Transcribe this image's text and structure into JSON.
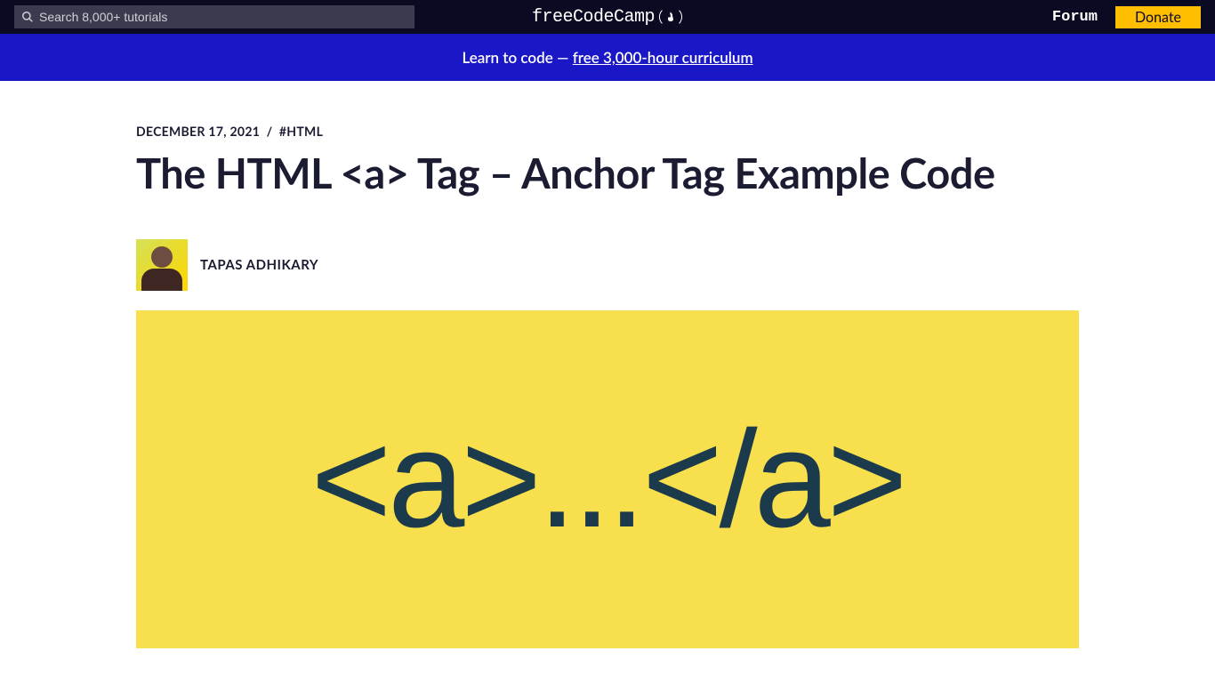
{
  "header": {
    "search_placeholder": "Search 8,000+ tutorials",
    "logo_text": "freeCodeCamp",
    "forum_label": "Forum",
    "donate_label": "Donate"
  },
  "banner": {
    "prefix": "Learn to code — ",
    "link_text": "free 3,000-hour curriculum"
  },
  "article": {
    "date": "DECEMBER 17, 2021",
    "separator": "/",
    "tag": "#HTML",
    "title": "The HTML <a> Tag – Anchor Tag Example Code",
    "author_name": "TAPAS ADHIKARY",
    "hero_text": "<a>...</a>"
  }
}
